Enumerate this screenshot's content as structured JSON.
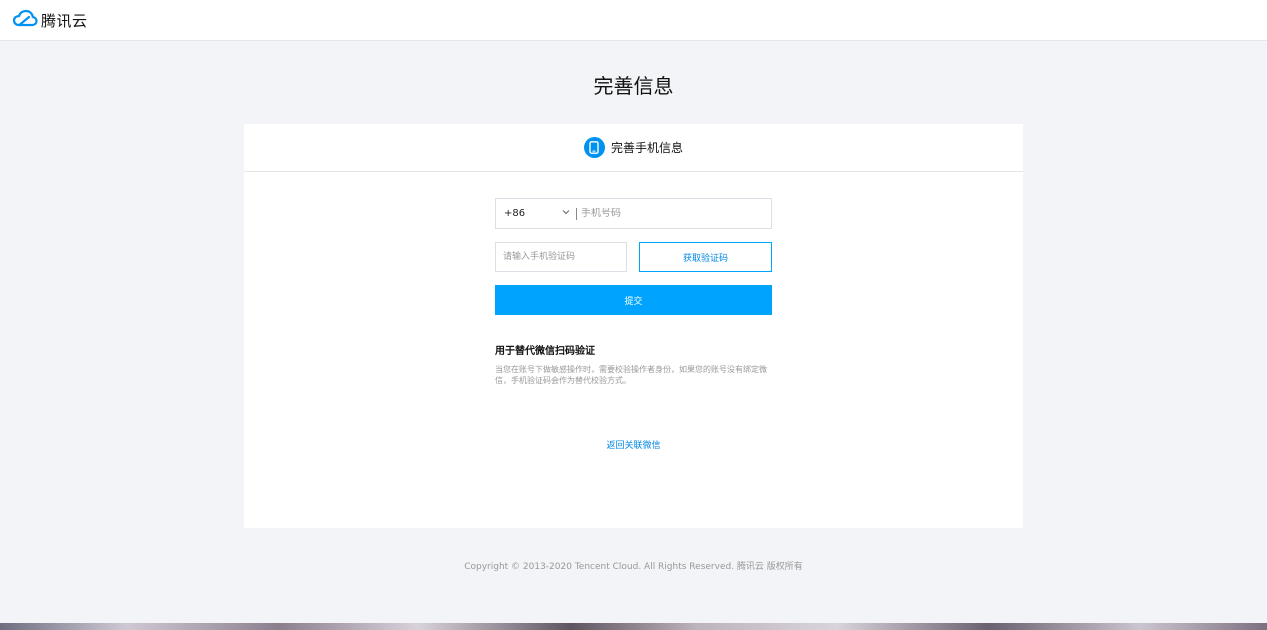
{
  "brand": {
    "name": "腾讯云",
    "color": "#0091f1"
  },
  "page": {
    "title": "完善信息"
  },
  "card": {
    "header_title": "完善手机信息",
    "header_icon": "phone-icon"
  },
  "form": {
    "country_code": "+86",
    "phone_placeholder": "手机号码",
    "code_placeholder": "请输入手机验证码",
    "get_code_label": "获取验证码",
    "submit_label": "提交"
  },
  "info": {
    "title": "用于替代微信扫码验证",
    "description": "当您在账号下做敏感操作时，需要校验操作者身份，如果您的账号没有绑定微信，手机验证码会作为替代校验方式。"
  },
  "links": {
    "back_label": "返回关联微信"
  },
  "footer": {
    "copyright": "Copyright © 2013-2020 Tencent Cloud. All Rights Reserved. 腾讯云 版权所有"
  },
  "colors": {
    "accent": "#00a4ff",
    "link": "#0087e6",
    "background": "#f3f4f7"
  }
}
